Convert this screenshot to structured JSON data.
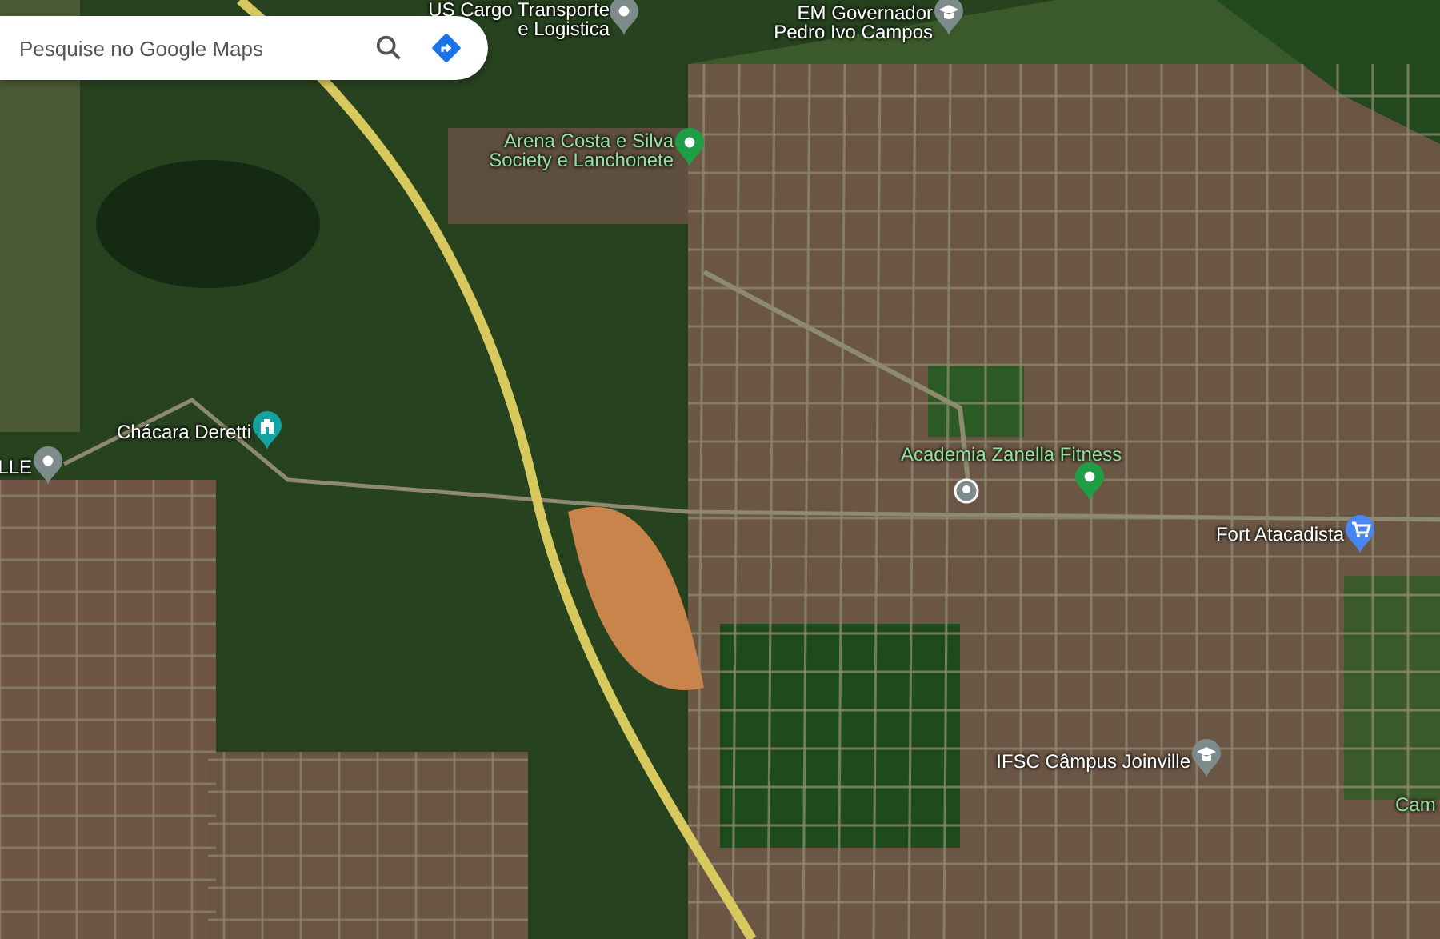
{
  "search": {
    "placeholder": "Pesquise no Google Maps"
  },
  "places": [
    {
      "lines": [
        "US Cargo Transporte",
        "e Logistica"
      ],
      "kind": "pin",
      "color": "#7d8b8a",
      "highlighted": false
    },
    {
      "lines": [
        "EM Governador",
        "Pedro Ivo Campos"
      ],
      "kind": "school",
      "color": "#7d8b8a",
      "highlighted": false
    },
    {
      "lines": [
        "Arena Costa e Silva",
        "Society e Lanchonete"
      ],
      "kind": "pin",
      "color": "#1e9e45",
      "highlighted": true
    },
    {
      "lines": [
        "Chácara Deretti"
      ],
      "kind": "building",
      "color": "#13a3a3",
      "highlighted": false
    },
    {
      "lines": [
        "LLE"
      ],
      "kind": "pin",
      "color": "#7d8b8a",
      "highlighted": false
    },
    {
      "lines": [
        "Academia Zanella Fitness"
      ],
      "kind": "pin",
      "color": "#1e9e45",
      "highlighted": true
    },
    {
      "kind": "dot",
      "color": "#7d8b8a"
    },
    {
      "lines": [
        "Fort Atacadista"
      ],
      "kind": "cart",
      "color": "#4a86f0",
      "highlighted": false
    },
    {
      "lines": [
        "IFSC Câmpus Joinville"
      ],
      "kind": "school",
      "color": "#7d8b8a",
      "highlighted": false
    },
    {
      "lines": [
        "Cam"
      ],
      "kind": "label",
      "highlighted": true
    }
  ]
}
